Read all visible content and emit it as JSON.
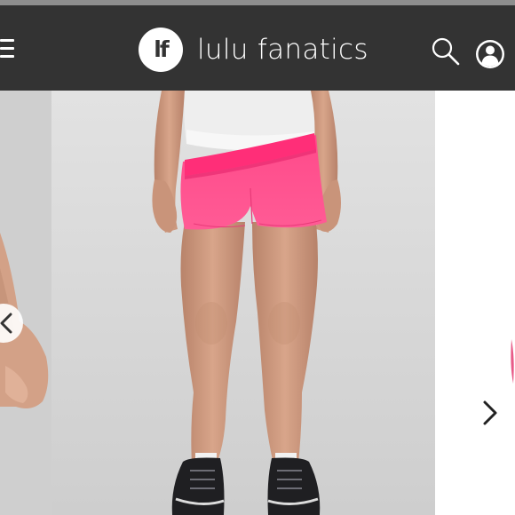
{
  "header": {
    "logo_monogram": "lf",
    "brand_name": "lulu fanatics",
    "background": "#333333"
  },
  "product_gallery": {
    "main_image": "pink running shorts worn with a white top and black sneakers",
    "colors": {
      "shorts": "#ff4f8e",
      "waistband": "#ff2f7a"
    }
  },
  "icons": {
    "menu": "menu-icon",
    "search": "search-icon",
    "profile": "user-profile-icon",
    "prev": "chevron-left-icon",
    "next": "chevron-right-icon"
  }
}
